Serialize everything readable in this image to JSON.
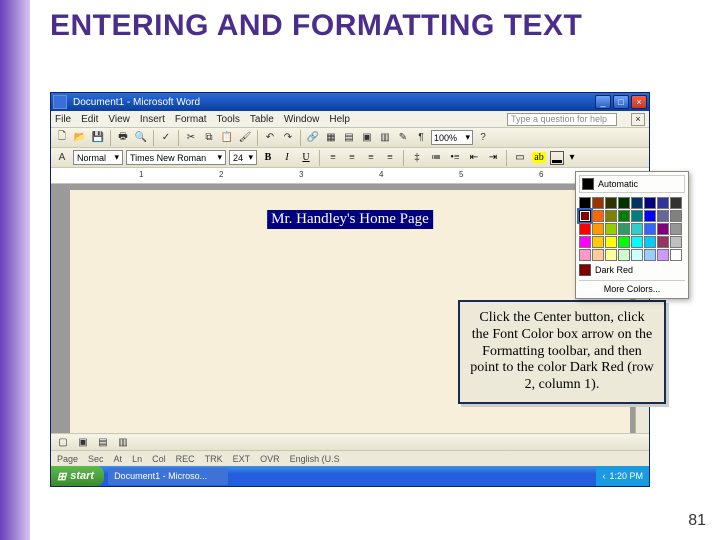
{
  "slide": {
    "title": "ENTERING AND FORMATTING TEXT",
    "page_number": "81"
  },
  "word": {
    "titlebar": {
      "icon": "word-icon",
      "text": "Document1 - Microsoft Word"
    },
    "menu": {
      "items": [
        "File",
        "Edit",
        "View",
        "Insert",
        "Format",
        "Tools",
        "Table",
        "Window",
        "Help"
      ],
      "help_placeholder": "Type a question for help"
    },
    "standard_toolbar": {
      "zoom": "100%"
    },
    "formatting_toolbar": {
      "style": "Normal",
      "font": "Times New Roman",
      "size": "24"
    },
    "ruler": {
      "labels": [
        "1",
        "2",
        "3",
        "4",
        "5",
        "6"
      ]
    },
    "document": {
      "selected_text": "Mr. Handley's Home Page"
    },
    "statusbar": {
      "items": [
        "Page",
        "Sec",
        "At",
        "Ln",
        "Col",
        "REC",
        "TRK",
        "EXT",
        "OVR",
        "English (U.S"
      ]
    },
    "taskbar": {
      "start": "start",
      "task_item": "Document1 - Microso...",
      "time": "1:20 PM"
    }
  },
  "color_picker": {
    "automatic_label": "Automatic",
    "highlighted_name": "Dark Red",
    "more_colors": "More Colors...",
    "rows": [
      [
        "#000000",
        "#993300",
        "#333300",
        "#003300",
        "#003366",
        "#000080",
        "#333399",
        "#333333"
      ],
      [
        "#800000",
        "#ff6600",
        "#808000",
        "#008000",
        "#008080",
        "#0000ff",
        "#666699",
        "#808080"
      ],
      [
        "#ff0000",
        "#ff9900",
        "#99cc00",
        "#339966",
        "#33cccc",
        "#3366ff",
        "#800080",
        "#969696"
      ],
      [
        "#ff00ff",
        "#ffcc00",
        "#ffff00",
        "#00ff00",
        "#00ffff",
        "#00ccff",
        "#993366",
        "#c0c0c0"
      ],
      [
        "#ff99cc",
        "#ffcc99",
        "#ffff99",
        "#ccffcc",
        "#ccffff",
        "#99ccff",
        "#cc99ff",
        "#ffffff"
      ]
    ],
    "highlighted_color": "#800000"
  },
  "callout": {
    "text": "Click the Center button, click the Font Color box arrow on the Formatting toolbar, and then point to the color Dark Red (row 2, column 1)."
  }
}
